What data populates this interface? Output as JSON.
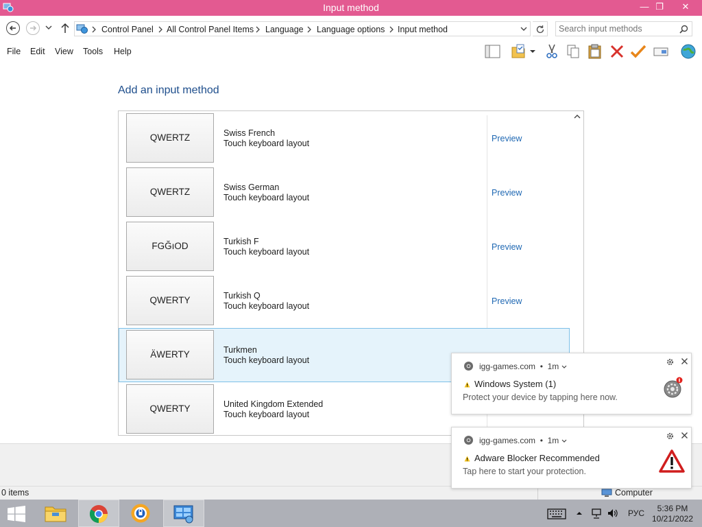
{
  "window": {
    "title": "Input method",
    "minimize_glyph": "—",
    "maximize_glyph": "❐",
    "close_glyph": "✕"
  },
  "address": {
    "breadcrumbs": [
      "Control Panel",
      "All Control Panel Items",
      "Language",
      "Language options",
      "Input method"
    ],
    "search_placeholder": "Search input methods"
  },
  "menu": {
    "items": [
      "File",
      "Edit",
      "View",
      "Tools",
      "Help"
    ]
  },
  "toolbar_icons": [
    "layout-icon",
    "folder-properties-icon",
    "cut-icon",
    "copy-icon",
    "paste-icon",
    "delete-icon",
    "checkmark-icon",
    "rename-icon",
    "globe-icon"
  ],
  "main": {
    "heading": "Add an input method",
    "rows": [
      {
        "key_label": "QWERTZ",
        "name": "Swiss French",
        "desc": "Touch keyboard layout",
        "preview": "Preview"
      },
      {
        "key_label": "QWERTZ",
        "name": "Swiss German",
        "desc": "Touch keyboard layout",
        "preview": "Preview"
      },
      {
        "key_label": "FGĞıOD",
        "name": "Turkish F",
        "desc": "Touch keyboard layout",
        "preview": "Preview"
      },
      {
        "key_label": "QWERTY",
        "name": "Turkish Q",
        "desc": "Touch keyboard layout",
        "preview": "Preview"
      },
      {
        "key_label": "ÄWERTY",
        "name": "Turkmen",
        "desc": "Touch keyboard layout",
        "preview": ""
      },
      {
        "key_label": "QWERTY",
        "name": "United Kingdom Extended",
        "desc": "Touch keyboard layout",
        "preview": ""
      }
    ],
    "selected_row": 4
  },
  "status": {
    "items": "0 items",
    "location": "Computer"
  },
  "notifications": [
    {
      "source": "igg-games.com",
      "age": "1m",
      "title": "Windows System (1)",
      "body": "Protect your device by tapping here now."
    },
    {
      "source": "igg-games.com",
      "age": "1m",
      "title": "Adware Blocker Recommended",
      "body": "Tap here to start your protection."
    }
  ],
  "taskbar": {
    "apps": [
      "file-explorer-icon",
      "chrome-icon",
      "avast-secure-browser-icon",
      "control-panel-icon"
    ],
    "lang": "РУС",
    "time": "5:36 PM",
    "date": "10/21/2022"
  },
  "colors": {
    "titlebar": "#e35a91",
    "heading": "#1e4e8c",
    "link": "#1f68b3",
    "selection": "#e5f3fb",
    "taskbar": "#aeb0b7"
  }
}
